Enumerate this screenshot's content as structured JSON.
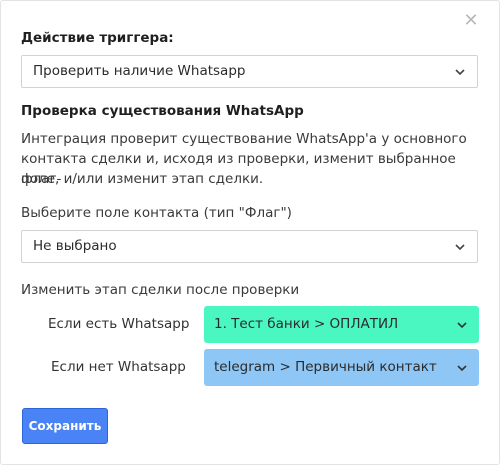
{
  "dialog": {
    "close_glyph": "✕",
    "trigger_action": {
      "label": "Действие триггера:",
      "selected": "Проверить наличие Whatsapp"
    },
    "section_title": "Проверка существования WhatsApp",
    "description": [
      "Интеграция проверит существование WhatsApp'а у основного",
      "контакта сделки и, исходя из проверки, изменит выбранное флаг-",
      "поле, и/или изменит этап сделки."
    ],
    "contact_field": {
      "label": "Выберите поле контакта (тип \"Флаг\")",
      "selected": "Не выбрано"
    },
    "stage_change": {
      "label": "Изменить этап сделки после проверки",
      "has_whatsapp": {
        "label": "Если есть Whatsapp",
        "selected": "1. Тест банки > ОПЛАТИЛ",
        "color": "#4af7c1"
      },
      "no_whatsapp": {
        "label": "Если нет Whatsapp",
        "selected": "telegram > Первичный контакт",
        "color": "#8ec6f5"
      }
    },
    "save_button": "Сохранить",
    "colors": {
      "primary_button": "#4a83f6",
      "border": "#d2d2d2"
    }
  }
}
